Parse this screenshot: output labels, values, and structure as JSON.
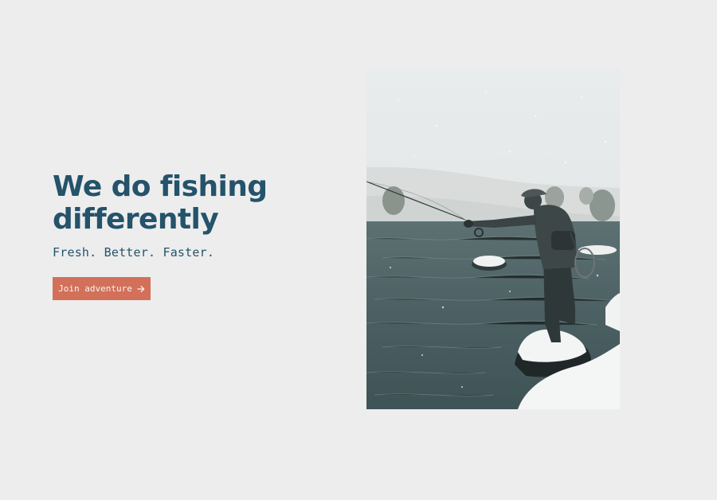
{
  "hero": {
    "title_line1": "We do fishing",
    "title_line2": "differently",
    "subtitle": "Fresh. Better. Faster.",
    "cta_label": "Join adventure",
    "cta_icon": "arrow-right-icon"
  },
  "photo": {
    "subject": "fly fisherman casting in a snowy river"
  },
  "colors": {
    "background": "#ededed",
    "heading": "#24536a",
    "accent": "#d2705a"
  }
}
